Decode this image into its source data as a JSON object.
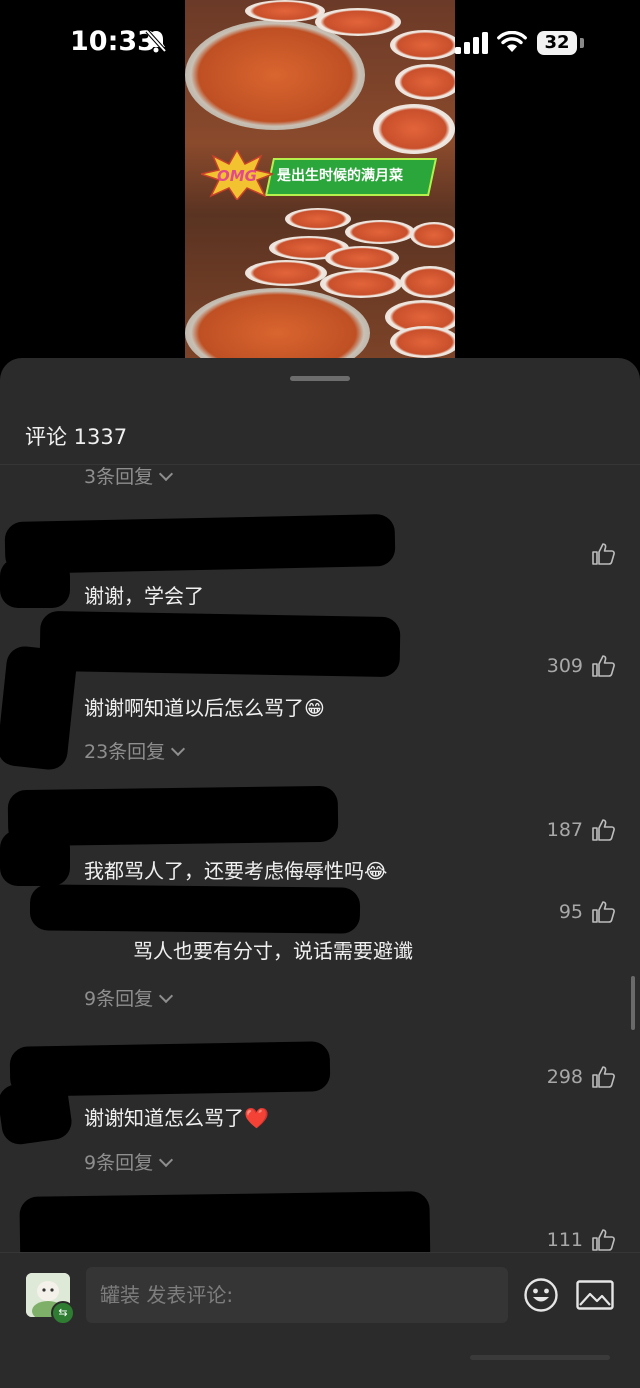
{
  "status_bar": {
    "time": "10:33",
    "battery": "32"
  },
  "video": {
    "banner_text": "是出生时候的满月菜",
    "sticker_text": "OMG"
  },
  "comments_sheet": {
    "title": "评论 1337",
    "items": [
      {
        "kind": "reply_link",
        "label": "3条回复"
      },
      {
        "kind": "comment",
        "text": "谢谢，学会了",
        "likes": ""
      },
      {
        "kind": "comment",
        "text": "谢谢啊知道以后怎么骂了😁",
        "likes": "309"
      },
      {
        "kind": "reply_link",
        "label": "23条回复"
      },
      {
        "kind": "comment",
        "text": "我都骂人了，还要考虑侮辱性吗😂",
        "likes": "187"
      },
      {
        "kind": "reply",
        "text": "骂人也要有分寸，说话需要避谶",
        "likes": "95"
      },
      {
        "kind": "reply_link",
        "label": "9条回复"
      },
      {
        "kind": "comment",
        "text": "谢谢知道怎么骂了❤️",
        "likes": "298"
      },
      {
        "kind": "reply_link",
        "label": "9条回复"
      },
      {
        "kind": "comment",
        "text": "",
        "likes": "111"
      }
    ]
  },
  "composer": {
    "placeholder": "罐装 发表评论:"
  },
  "icons": {
    "mute": "bell-slash-icon",
    "signal": "cellular-signal-icon",
    "wifi": "wifi-icon",
    "like": "thumbs-up-icon",
    "emoji": "emoji-icon",
    "image": "image-icon"
  }
}
